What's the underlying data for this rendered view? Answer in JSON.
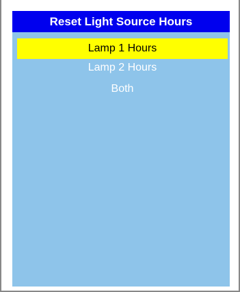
{
  "menu": {
    "title": "Reset Light Source Hours",
    "items": [
      {
        "label": "Lamp 1 Hours",
        "selected": true
      },
      {
        "label": "Lamp 2 Hours",
        "selected": false
      },
      {
        "label": "Both",
        "selected": false
      }
    ]
  },
  "colors": {
    "panel_background": "#8ec4ea",
    "title_background": "#0000ee",
    "title_text": "#ffffff",
    "item_text": "#ffffff",
    "selected_background": "#ffff00",
    "selected_text": "#000000",
    "frame_border": "#888888"
  }
}
